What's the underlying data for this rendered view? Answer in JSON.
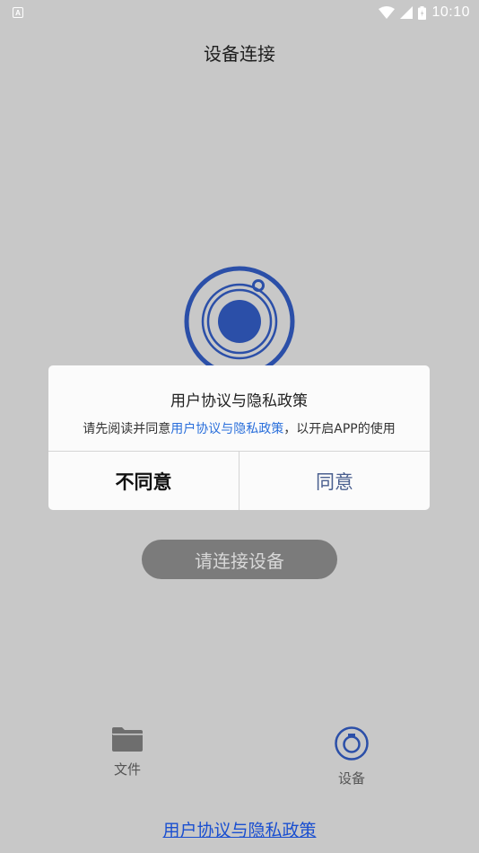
{
  "status_bar": {
    "notification_icon_letter": "A",
    "time": "10:10"
  },
  "header": {
    "title": "设备连接"
  },
  "main": {
    "connect_button_label": "请连接设备"
  },
  "dialog": {
    "title": "用户协议与隐私政策",
    "message_prefix": "请先阅读并同意",
    "message_link": "用户协议与隐私政策",
    "message_suffix": "，以开启APP的使用",
    "disagree_label": "不同意",
    "agree_label": "同意"
  },
  "bottom_nav": {
    "items": [
      {
        "label": "文件",
        "icon": "folder-icon"
      },
      {
        "label": "设备",
        "icon": "device-icon"
      }
    ]
  },
  "footer": {
    "policy_link": "用户协议与隐私政策"
  },
  "colors": {
    "accent_blue": "#2b4fa8",
    "link_blue": "#2a6fdb",
    "overlay_bg": "#c8c8c8"
  }
}
